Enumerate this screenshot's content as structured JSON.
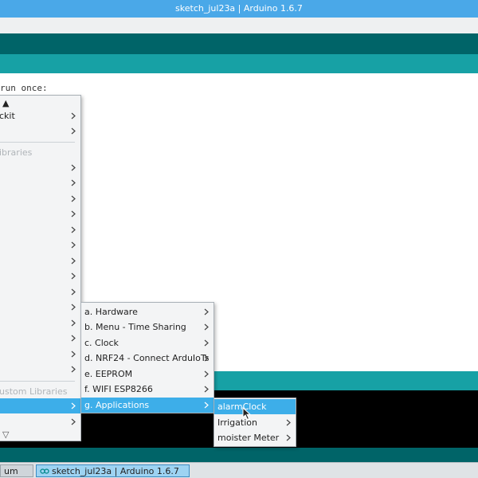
{
  "window": {
    "title": "sketch_jul23a | Arduino 1.6.7"
  },
  "editor": {
    "code_fragment": "run once:"
  },
  "board_menu": {
    "scroll_up_glyph": "▲",
    "scroll_down_glyph": "▽",
    "item_kit_label": "ckit",
    "section_libraries": "ibraries",
    "section_custom_libraries": "ustom Libraries"
  },
  "custom_submenu": {
    "items": [
      {
        "label": "a. Hardware"
      },
      {
        "label": "b. Menu - Time Sharing"
      },
      {
        "label": "c. Clock"
      },
      {
        "label": "d. NRF24 - Connect ArduIoTs"
      },
      {
        "label": "e. EEPROM"
      },
      {
        "label": "f. WIFI ESP8266"
      },
      {
        "label": "g. Applications"
      }
    ]
  },
  "applications_submenu": {
    "items": [
      {
        "label": "alarmClock"
      },
      {
        "label": "Irrigation"
      },
      {
        "label": "moister Meter"
      }
    ]
  },
  "taskbar": {
    "item1": "um",
    "item2": "sketch_jul23a | Arduino 1.6.7"
  },
  "colors": {
    "titlebar": "#4aa8e8",
    "toolbar": "#006468",
    "tabstrip": "#17a1a5",
    "highlight": "#3daee9",
    "console": "#000000"
  },
  "icons": [
    "chevron-right-icon",
    "arduino-logo-icon",
    "mouse-cursor-icon"
  ]
}
